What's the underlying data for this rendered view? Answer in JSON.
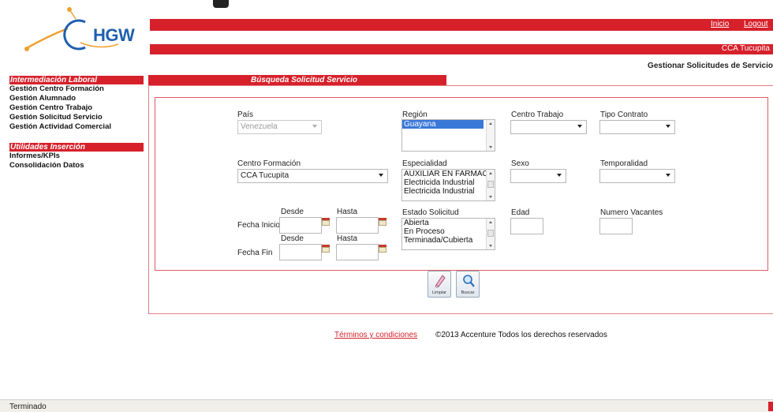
{
  "header": {
    "logo_text": "HGW",
    "nav_links": [
      "Inicio",
      "Logout"
    ],
    "center_name": "CCA Tucupita",
    "page_heading": "Gestionar Solicitudes de Servicio"
  },
  "sidebar": {
    "section1_title": "Intermediación Laboral",
    "section1_items": [
      "Gestión Centro Formación",
      "Gestión Alumnado",
      "Gestión Centro Trabajo",
      "Gestión Solicitud Servicio",
      "Gestión Actividad Comercial"
    ],
    "section2_title": "Utilidades Inserción",
    "section2_items": [
      "Informes/KPIs",
      "Consolidación Datos"
    ]
  },
  "form": {
    "tab_title": "Búsqueda Solicitud Servicio",
    "pais": {
      "label": "País",
      "value": "Venezuela"
    },
    "region": {
      "label": "Región",
      "options": [
        "Guayana"
      ],
      "selected": "Guayana"
    },
    "centro_trabajo": {
      "label": "Centro Trabajo",
      "value": ""
    },
    "tipo_contrato": {
      "label": "Tipo Contrato",
      "value": ""
    },
    "centro_formacion": {
      "label": "Centro Formación",
      "value": "CCA Tucupita"
    },
    "especialidad": {
      "label": "Especialidad",
      "options": [
        "AUXILIAR EN FARMACIA",
        "Electricida Industrial",
        "Electricida Industrial"
      ]
    },
    "sexo": {
      "label": "Sexo",
      "value": ""
    },
    "temporalidad": {
      "label": "Temporalidad",
      "value": ""
    },
    "fecha_inicio": {
      "label": "Fecha Inicio",
      "desde": "Desde",
      "hasta": "Hasta"
    },
    "fecha_fin": {
      "label": "Fecha Fin",
      "desde": "Desde",
      "hasta": "Hasta"
    },
    "estado_solicitud": {
      "label": "Estado Solicitud",
      "options": [
        "Abierta",
        "En Proceso",
        "Terminada/Cubierta"
      ]
    },
    "edad": {
      "label": "Edad",
      "value": ""
    },
    "numero_vacantes": {
      "label": "Numero Vacantes",
      "value": ""
    }
  },
  "buttons": {
    "limpiar": "Limpiar",
    "buscar": "Buscar"
  },
  "footer": {
    "terms": "Términos y condiciones",
    "copyright": "©2013 Accenture Todos los derechos reservados"
  },
  "status": {
    "text": "Terminado"
  },
  "colors": {
    "brand_red": "#d6212b",
    "brand_blue": "#1f5fae",
    "logo_orange": "#f0a030",
    "selection_blue": "#3a78d8"
  }
}
